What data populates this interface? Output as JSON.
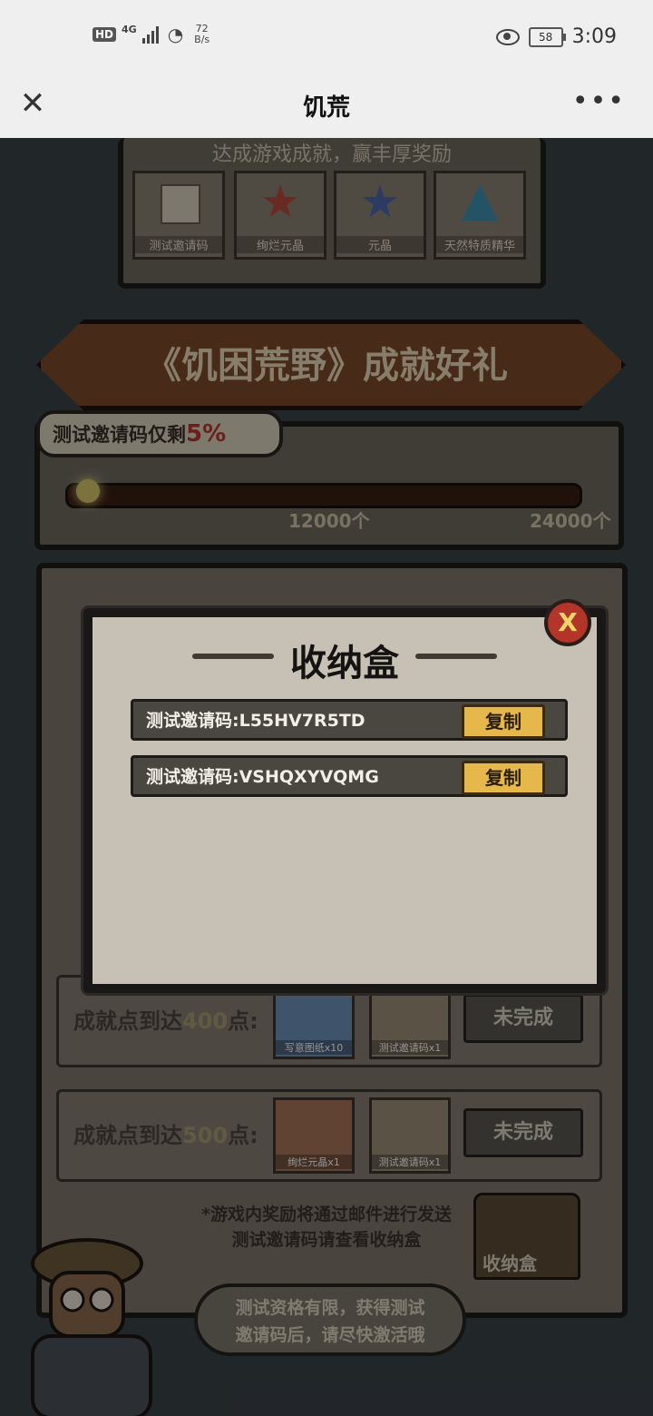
{
  "status_bar": {
    "hd": "HD",
    "network": "4G",
    "speed_value": "72",
    "speed_unit": "B/s",
    "battery": "58",
    "time": "3:09"
  },
  "nav": {
    "title": "饥荒",
    "close_icon": "close-icon",
    "more_icon": "more-icon"
  },
  "page": {
    "strip_heading": "达成游戏成就，赢丰厚奖励",
    "top_rewards": [
      "测试邀请码",
      "绚烂元晶",
      "元晶",
      "天然特质精华"
    ],
    "banner_title": "《饥困荒野》成就好礼",
    "remaining_label": "测试邀请码仅剩",
    "remaining_pct": "5%",
    "progress_fraction": 0.05,
    "ticks": [
      "12000个",
      "24000个"
    ],
    "rows": [
      {
        "label_pre": "成就点到达",
        "num": "400",
        "label_post": "点:",
        "rewards": [
          "写意图纸x10",
          "测试邀请码x1"
        ],
        "button": "未完成"
      },
      {
        "label_pre": "成就点到达",
        "num": "500",
        "label_post": "点:",
        "rewards": [
          "绚烂元晶x1",
          "测试邀请码x1"
        ],
        "button": "未完成"
      }
    ],
    "notice_line1": "*游戏内奖励将通过邮件进行发送",
    "notice_line2": "测试邀请码请查看收纳盒",
    "chest_label": "收纳盒",
    "bubble_line1": "测试资格有限，获得测试",
    "bubble_line2": "邀请码后，请尽快激活哦"
  },
  "modal": {
    "title": "收纳盒",
    "close_label": "X",
    "codes": [
      {
        "text": "测试邀请码:L55HV7R5TD",
        "button": "复制"
      },
      {
        "text": "测试邀请码:VSHQXYVQMG",
        "button": "复制"
      }
    ]
  }
}
